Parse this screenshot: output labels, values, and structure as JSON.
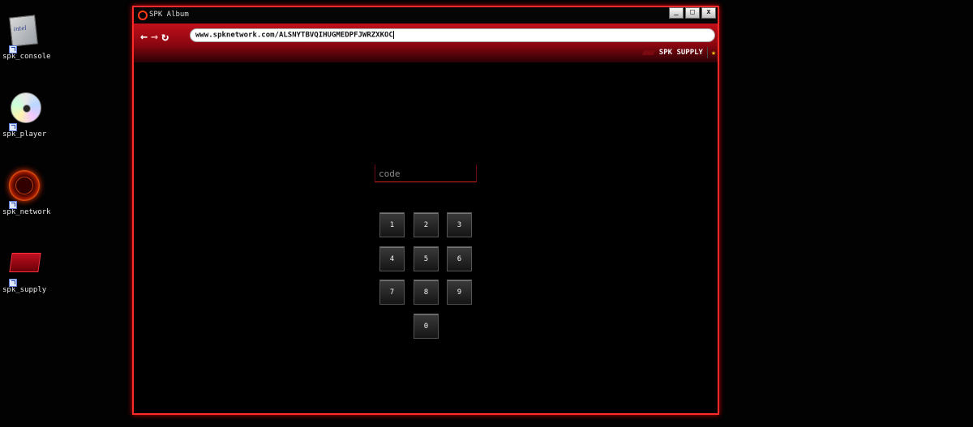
{
  "desktop": {
    "icons": [
      {
        "label": "spk_console",
        "icon": "intel-chip-icon",
        "chip_text": "intel"
      },
      {
        "label": "spk_player",
        "icon": "cd-disc-icon"
      },
      {
        "label": "spk_network",
        "icon": "network-globe-icon"
      },
      {
        "label": "spk_supply",
        "icon": "supply-crate-icon"
      }
    ]
  },
  "window": {
    "title": "SPK Album",
    "controls": {
      "minimize": "_",
      "maximize": "□",
      "close": "x"
    }
  },
  "navbar": {
    "back": "←",
    "forward": "→",
    "reload": "↻",
    "url": "www.spknetwork.com/ALSNYTBVQIHUGMEDPFJWRZXKOC"
  },
  "subbar": {
    "supply_label": "SPK SUPPLY",
    "star": "★"
  },
  "code_input": {
    "placeholder": "code",
    "value": ""
  },
  "keypad": {
    "keys": [
      "1",
      "2",
      "3",
      "4",
      "5",
      "6",
      "7",
      "8",
      "9",
      "0"
    ]
  },
  "colors": {
    "accent": "#ff2a2a",
    "navbar_top": "#c0101a",
    "star": "#f5c400"
  }
}
